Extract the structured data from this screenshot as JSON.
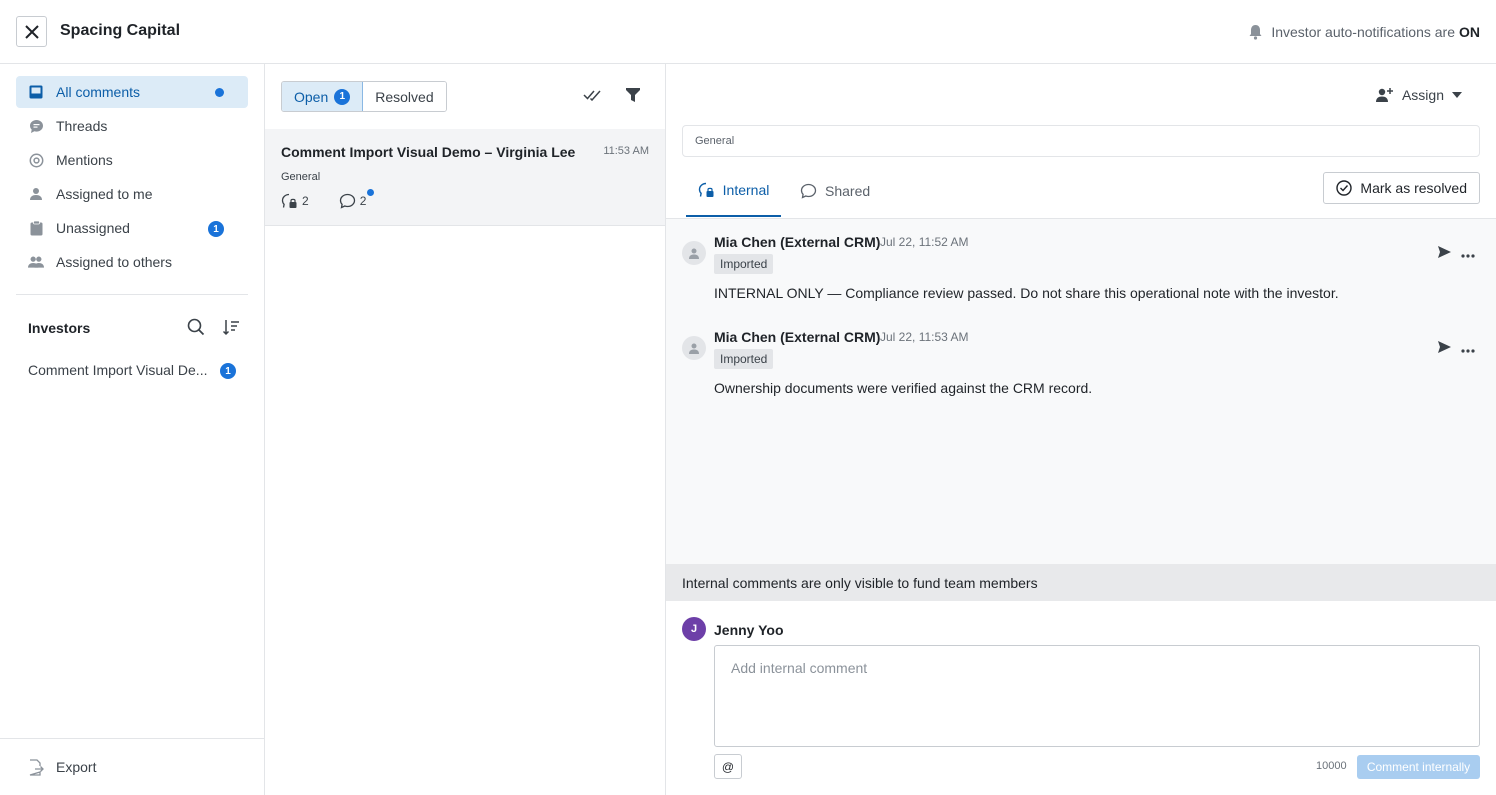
{
  "header": {
    "title": "Spacing Capital",
    "notification_text": "Investor auto-notifications are",
    "notification_state": "ON"
  },
  "sidebar": {
    "items": [
      {
        "label": "All comments",
        "icon": "inbox-icon",
        "indicator": "dot"
      },
      {
        "label": "Threads",
        "icon": "chat-bubble-icon"
      },
      {
        "label": "Mentions",
        "icon": "at-icon"
      },
      {
        "label": "Assigned to me",
        "icon": "person-icon"
      },
      {
        "label": "Unassigned",
        "icon": "clipboard-icon",
        "badge": "1"
      },
      {
        "label": "Assigned to others",
        "icon": "people-icon"
      }
    ],
    "investors_heading": "Investors",
    "investors": [
      {
        "label": "Comment Import Visual De...",
        "badge": "1"
      }
    ],
    "export_label": "Export"
  },
  "middle": {
    "filter_tabs": [
      {
        "label": "Open",
        "badge": "1",
        "active": true
      },
      {
        "label": "Resolved"
      }
    ],
    "threads": [
      {
        "title": "Comment Import Visual Demo – Virginia Lee",
        "time": "11:53 AM",
        "tag": "General",
        "internal_count": "2",
        "shared_count": "2"
      }
    ]
  },
  "detail": {
    "assign_label": "Assign",
    "topic": "General",
    "tabs": [
      {
        "label": "Internal",
        "active": true
      },
      {
        "label": "Shared"
      }
    ],
    "resolve_label": "Mark as resolved",
    "comments": [
      {
        "author": "Mia Chen (External CRM)",
        "time": "Jul 22, 11:52 AM",
        "tag": "Imported",
        "body": "INTERNAL ONLY — Compliance review passed. Do not share this operational note with the investor."
      },
      {
        "author": "Mia Chen (External CRM)",
        "time": "Jul 22, 11:53 AM",
        "tag": "Imported",
        "body": "Ownership documents were verified against the CRM record."
      }
    ],
    "notice": "Internal comments are only visible to fund team members",
    "composer": {
      "avatar_initial": "J",
      "user_name": "Jenny Yoo",
      "value": "",
      "placeholder": "Add internal comment",
      "mention_label": "@",
      "char_limit": "10000",
      "submit_label": "Comment internally"
    }
  },
  "colors": {
    "accent": "#1a73d9",
    "active_bg": "#dcebf7",
    "avatar_user": "#6d3fa8"
  }
}
